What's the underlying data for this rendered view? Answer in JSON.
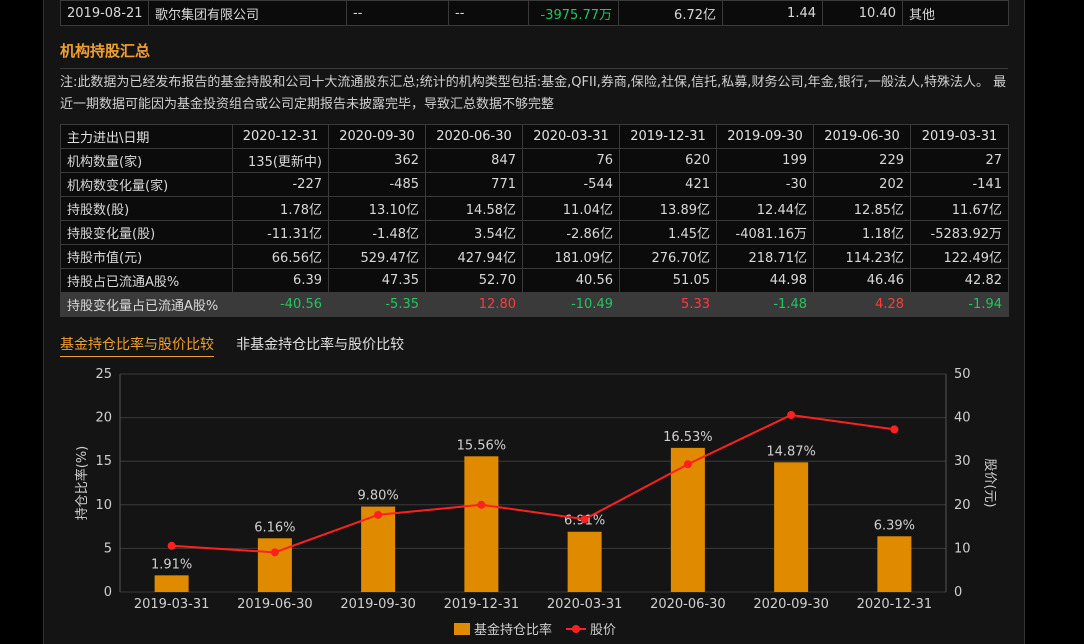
{
  "top_row": {
    "date": "2019-08-21",
    "name": "歌尔集团有限公司",
    "col3": "--",
    "col4": "--",
    "change": "-3975.77万",
    "value": "6.72亿",
    "pct1": "1.44",
    "pct2": "10.40",
    "type": "其他"
  },
  "section_title": "机构持股汇总",
  "note": "注:此数据为已经发布报告的基金持股和公司十大流通股东汇总;统计的机构类型包括:基金,QFII,券商,保险,社保,信托,私募,财务公司,年金,银行,一般法人,特殊法人。 最近一期数据可能因为基金投资组合或公司定期报告未披露完毕，导致汇总数据不够完整",
  "inst_table": {
    "header_label": "主力进出\\日期",
    "dates": [
      "2020-12-31",
      "2020-09-30",
      "2020-06-30",
      "2020-03-31",
      "2019-12-31",
      "2019-09-30",
      "2019-06-30",
      "2019-03-31"
    ],
    "rows": [
      {
        "label": "机构数量(家)",
        "values": [
          "135(更新中)",
          "362",
          "847",
          "76",
          "620",
          "199",
          "229",
          "27"
        ]
      },
      {
        "label": "机构数变化量(家)",
        "values": [
          "-227",
          "-485",
          "771",
          "-544",
          "421",
          "-30",
          "202",
          "-141"
        ]
      },
      {
        "label": "持股数(股)",
        "values": [
          "1.78亿",
          "13.10亿",
          "14.58亿",
          "11.04亿",
          "13.89亿",
          "12.44亿",
          "12.85亿",
          "11.67亿"
        ]
      },
      {
        "label": "持股变化量(股)",
        "values": [
          "-11.31亿",
          "-1.48亿",
          "3.54亿",
          "-2.86亿",
          "1.45亿",
          "-4081.16万",
          "1.18亿",
          "-5283.92万"
        ]
      },
      {
        "label": "持股市值(元)",
        "values": [
          "66.56亿",
          "529.47亿",
          "427.94亿",
          "181.09亿",
          "276.70亿",
          "218.71亿",
          "114.23亿",
          "122.49亿"
        ]
      },
      {
        "label": "持股占已流通A股%",
        "values": [
          "6.39",
          "47.35",
          "52.70",
          "40.56",
          "51.05",
          "44.98",
          "46.46",
          "42.82"
        ]
      }
    ],
    "last_row": {
      "label": "持股变化量占已流通A股%",
      "values": [
        "-40.56",
        "-5.35",
        "12.80",
        "-10.49",
        "5.33",
        "-1.48",
        "4.28",
        "-1.94"
      ],
      "colors": [
        "green",
        "green",
        "red",
        "green",
        "red",
        "green",
        "red",
        "green"
      ]
    }
  },
  "tabs": [
    "基金持仓比率与股价比较",
    "非基金持仓比率与股价比较"
  ],
  "colors": {
    "bar": "#e08a00",
    "line": "#ff2020",
    "accent": "#f0a030"
  },
  "chart_data": {
    "type": "bar",
    "categories": [
      "2019-03-31",
      "2019-06-30",
      "2019-09-30",
      "2019-12-31",
      "2020-03-31",
      "2020-06-30",
      "2020-09-30",
      "2020-12-31"
    ],
    "series": [
      {
        "name": "基金持仓比率",
        "type": "bar",
        "axis": "left",
        "values": [
          1.91,
          6.16,
          9.8,
          15.56,
          6.91,
          16.53,
          14.87,
          6.39
        ],
        "labels": [
          "1.91%",
          "6.16%",
          "9.80%",
          "15.56%",
          "6.91%",
          "16.53%",
          "14.87%",
          "6.39%"
        ]
      },
      {
        "name": "股价",
        "type": "line",
        "axis": "right",
        "values": [
          10.6,
          9.1,
          17.7,
          20.0,
          16.7,
          29.3,
          40.6,
          37.3
        ]
      }
    ],
    "ylabel_left": "持仓比率(%)",
    "ylabel_right": "股价(元)",
    "ylim_left": [
      0,
      25
    ],
    "ylim_right": [
      0,
      50
    ],
    "yticks_left": [
      "0",
      "5",
      "10",
      "15",
      "20",
      "25"
    ],
    "yticks_right": [
      "0",
      "10",
      "20",
      "30",
      "40",
      "50"
    ],
    "legend": {
      "placement": "bottom-center",
      "items": [
        "基金持仓比率",
        "股价"
      ]
    },
    "grid": true
  }
}
